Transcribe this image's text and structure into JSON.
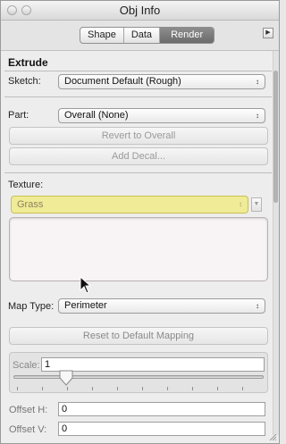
{
  "window": {
    "title": "Obj Info"
  },
  "tabs": [
    {
      "label": "Shape"
    },
    {
      "label": "Data"
    },
    {
      "label": "Render",
      "active": true
    }
  ],
  "section": {
    "title": "Extrude"
  },
  "sketch": {
    "label": "Sketch:",
    "value": "Document Default (Rough)"
  },
  "part": {
    "label": "Part:",
    "value": "Overall (None)"
  },
  "buttons": {
    "revert": "Revert to Overall",
    "add_decal": "Add Decal...",
    "reset_mapping": "Reset to Default Mapping"
  },
  "texture": {
    "label": "Texture:",
    "value": "Grass",
    "highlight_color": "#f0eb96"
  },
  "map_type": {
    "label": "Map Type:",
    "value": "Perimeter"
  },
  "scale": {
    "label": "Scale:",
    "value": "1"
  },
  "offset_h": {
    "label": "Offset H:",
    "value": "0"
  },
  "offset_v": {
    "label": "Offset V:",
    "value": "0"
  },
  "icons": {
    "popup_arrows": "↕",
    "menu_arrow": "▶",
    "small_down": "▼"
  }
}
